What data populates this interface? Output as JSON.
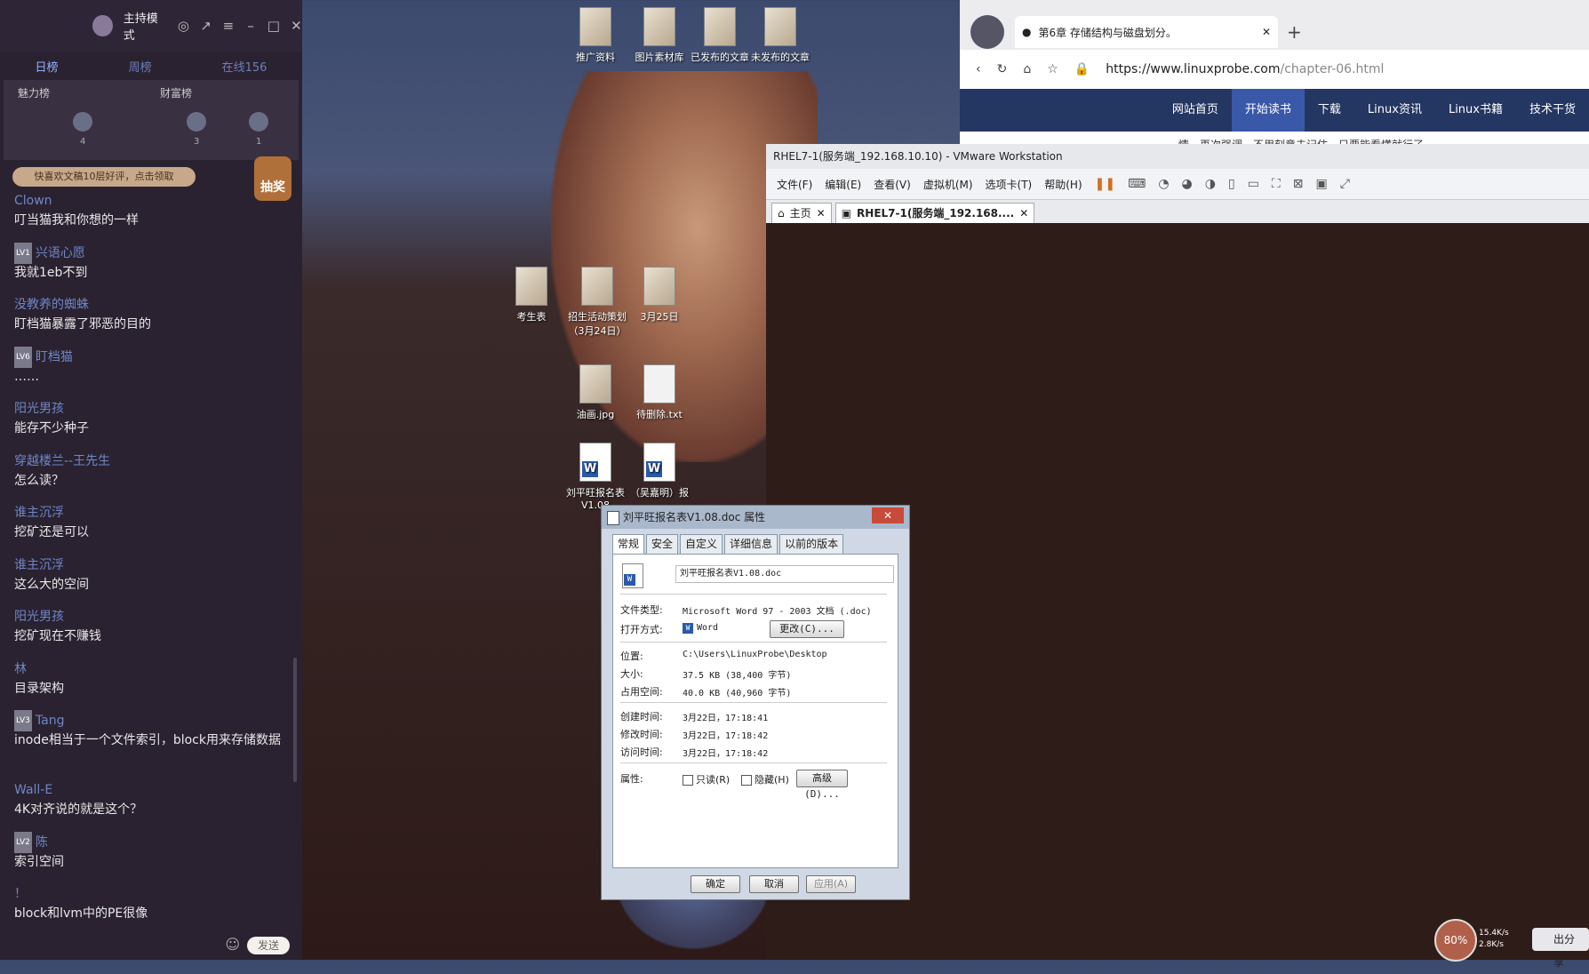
{
  "chat_app": {
    "title": "主持模式",
    "tabs": [
      "日榜",
      "周榜",
      "在线156"
    ],
    "ranks": {
      "charm_label": "魅力榜",
      "wealth_label": "财富榜",
      "counts": [
        "4",
        "3",
        "1"
      ]
    },
    "notice": "快喜欢文稿10层好评，点击领取",
    "lottery_label": "抽奖",
    "messages": [
      {
        "user": "Clown",
        "level": "",
        "text": "叮当猫我和你想的一样"
      },
      {
        "user": "兴语心愿",
        "level": "LV1",
        "text": "我就1eb不到"
      },
      {
        "user": "没教养的蜘蛛",
        "level": "",
        "text": "盯档猫暴露了邪恶的目的"
      },
      {
        "user": "盯档猫",
        "level": "LV6",
        "text": "……"
      },
      {
        "user": "阳光男孩",
        "level": "",
        "text": "能存不少种子"
      },
      {
        "user": "穿越楼兰--王先生",
        "level": "",
        "text": "怎么读？"
      },
      {
        "user": "谁主沉浮",
        "level": "",
        "text": "挖矿还是可以"
      },
      {
        "user": "谁主沉浮",
        "level": "",
        "text": "这么大的空间"
      },
      {
        "user": "阳光男孩",
        "level": "",
        "text": "挖矿现在不赚钱"
      },
      {
        "user": "林",
        "level": "",
        "text": "目录架构"
      },
      {
        "user": "Tang",
        "level": "LV3",
        "text": "inode相当于一个文件索引，block用来存储数据"
      },
      {
        "user": "Wall-E",
        "level": "",
        "text": "4K对齐说的就是这个？"
      },
      {
        "user": "陈",
        "level": "LV2",
        "text": "索引空间"
      },
      {
        "user": "！",
        "level": "",
        "text": "block和lvm中的PE很像"
      }
    ],
    "send_label": "发送"
  },
  "desktop": {
    "icons": [
      {
        "label": "推广资料",
        "type": "folder"
      },
      {
        "label": "图片素材库",
        "type": "folder"
      },
      {
        "label": "已发布的文章",
        "type": "folder"
      },
      {
        "label": "未发布的文章",
        "type": "folder"
      },
      {
        "label": "考生表",
        "type": "folder"
      },
      {
        "label": "招生活动策划（3月24日）",
        "type": "folder"
      },
      {
        "label": "3月25日",
        "type": "folder"
      },
      {
        "label": "油画.jpg",
        "type": "image"
      },
      {
        "label": "待删除.txt",
        "type": "text"
      },
      {
        "label": "刘平旺报名表V1.08",
        "type": "word"
      },
      {
        "label": "（吴嘉明）报",
        "type": "word"
      }
    ]
  },
  "browser": {
    "tab_title": "第6章 存储结构与磁盘划分。",
    "url_host": "https://www.linuxprobe.com",
    "url_path": "/chapter-06.html",
    "nav": [
      "网站首页",
      "开始读书",
      "下载",
      "Linux资讯",
      "Linux书籍",
      "技术干货"
    ],
    "body_text": "情，再次强调，不用刻意去记住，只要能看懂就行了。"
  },
  "vmware": {
    "title": "RHEL7-1(服务端_192.168.10.10) - VMware Workstation",
    "menus": [
      "文件(F)",
      "编辑(E)",
      "查看(V)",
      "虚拟机(M)",
      "选项卡(T)",
      "帮助(H)"
    ],
    "tabs": [
      "主页",
      "RHEL7-1(服务端_192.168...."
    ]
  },
  "properties": {
    "title": "刘平旺报名表V1.08.doc 属性",
    "tabs": [
      "常规",
      "安全",
      "自定义",
      "详细信息",
      "以前的版本"
    ],
    "filename": "刘平旺报名表V1.08.doc",
    "type_label": "文件类型:",
    "type_value": "Microsoft Word 97 - 2003 文档 (.doc)",
    "open_label": "打开方式:",
    "open_value": "Word",
    "change_btn": "更改(C)...",
    "location_label": "位置:",
    "location_value": "C:\\Users\\LinuxProbe\\Desktop",
    "size_label": "大小:",
    "size_value": "37.5 KB (38,400 字节)",
    "disk_label": "占用空间:",
    "disk_value": "40.0 KB (40,960 字节)",
    "created_label": "创建时间:",
    "created_value": "3月22日，17:18:41",
    "modified_label": "修改时间:",
    "modified_value": "3月22日，17:18:42",
    "accessed_label": "访问时间:",
    "accessed_value": "3月22日，17:18:42",
    "attr_label": "属性:",
    "readonly_label": "只读(R)",
    "hidden_label": "隐藏(H)",
    "advanced_btn": "高级(D)...",
    "ok_btn": "确定",
    "cancel_btn": "取消",
    "apply_btn": "应用(A)"
  },
  "tray": {
    "percent": "80%",
    "up": "15.4K/s",
    "down": "2.8K/s",
    "share_label": "出分享"
  }
}
